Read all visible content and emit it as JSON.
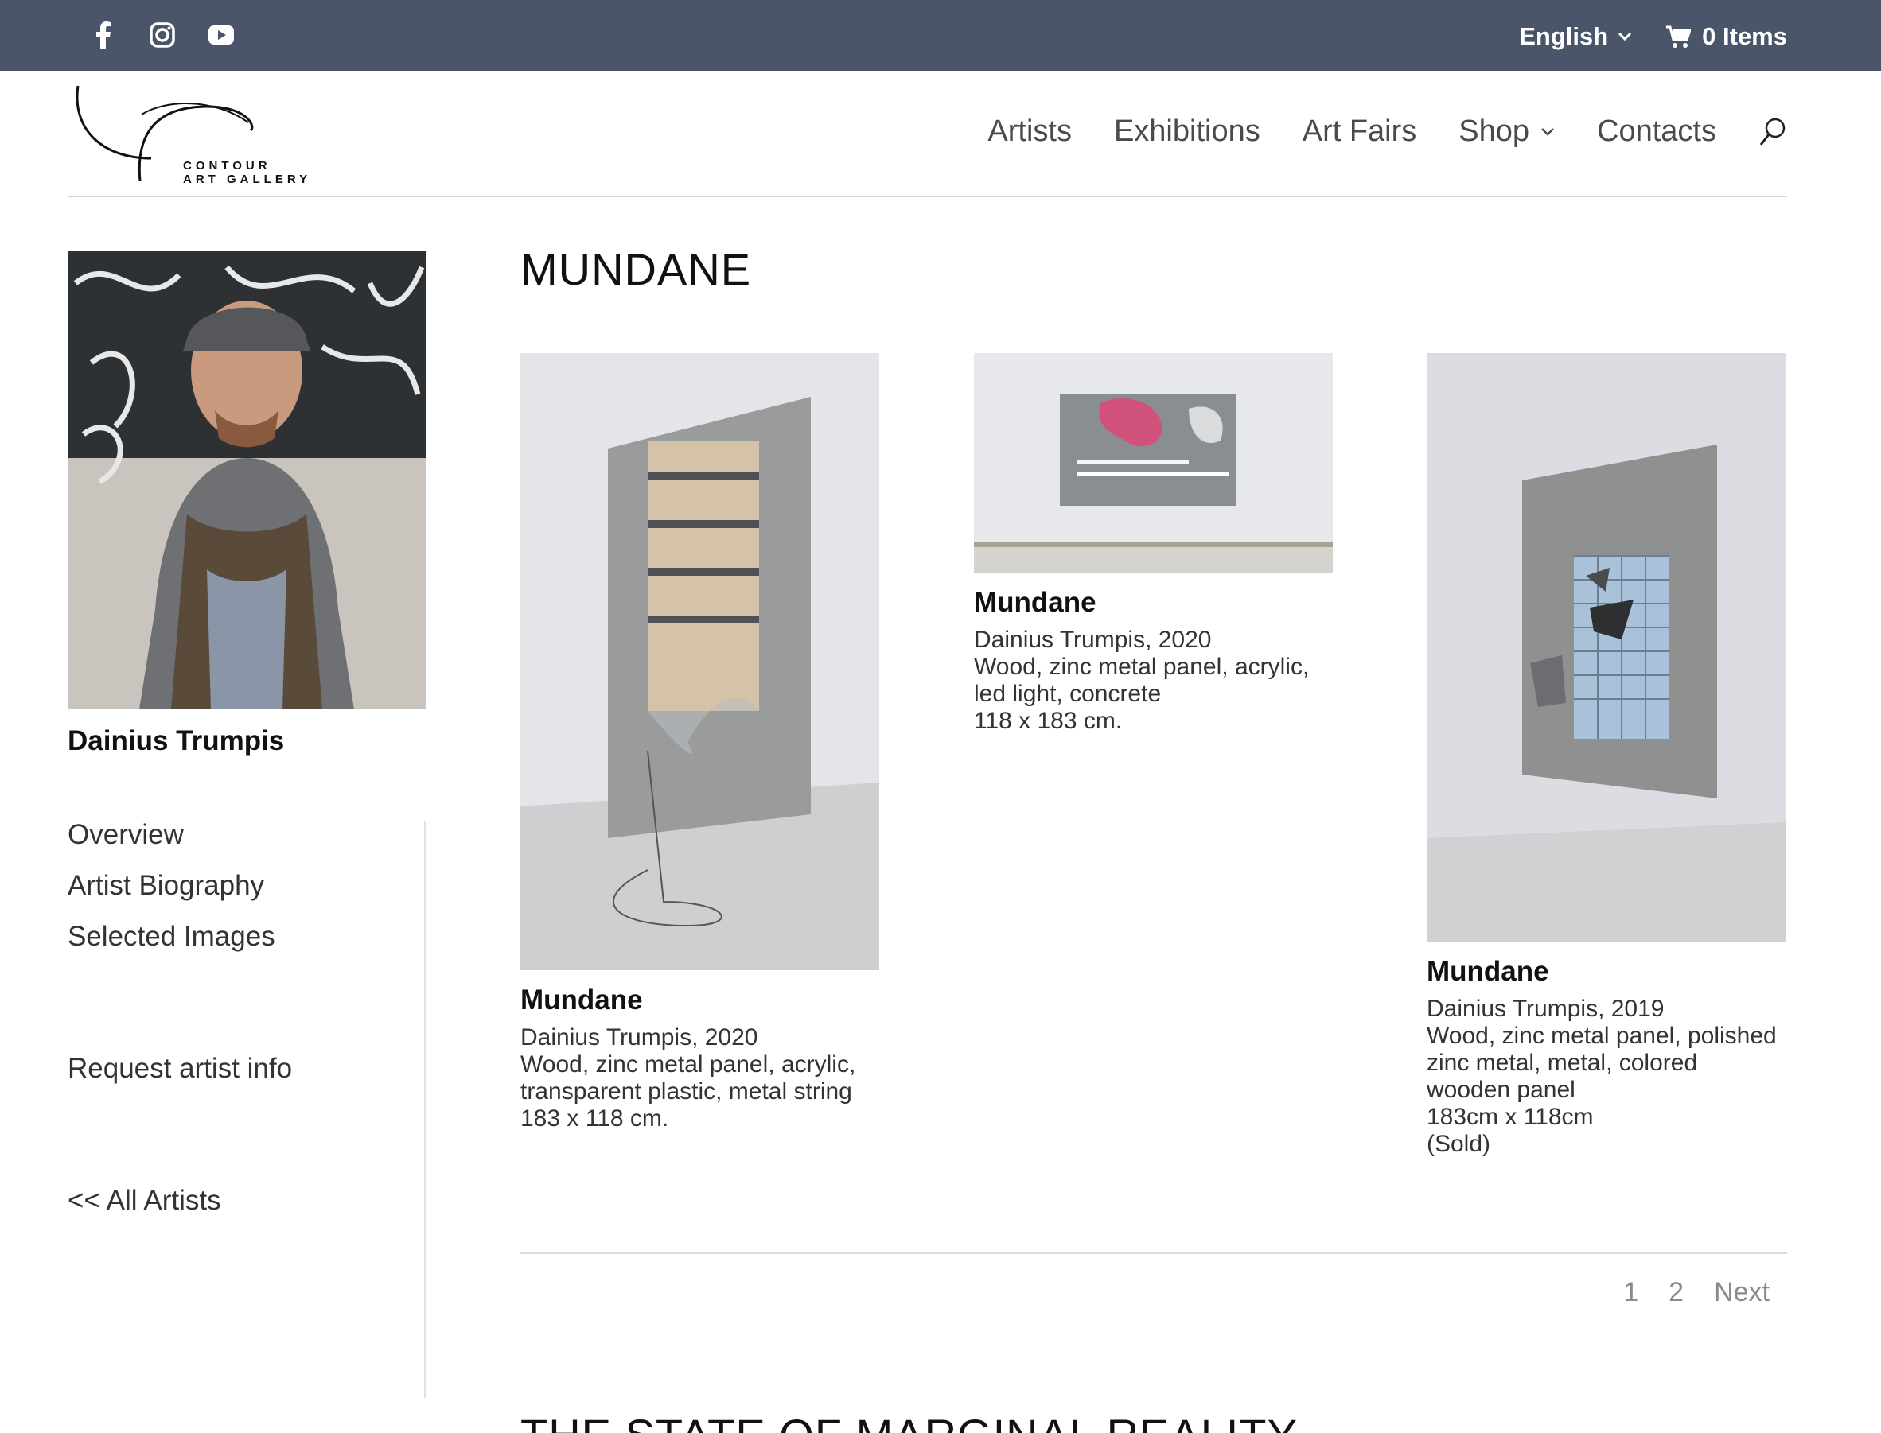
{
  "topbar": {
    "social": [
      "facebook-icon",
      "instagram-icon",
      "youtube-icon"
    ],
    "language": "English",
    "cart_label": "0 Items"
  },
  "logo": {
    "line1": "CONTOUR",
    "line2": "ART GALLERY"
  },
  "nav": {
    "items": [
      "Artists",
      "Exhibitions",
      "Art Fairs",
      "Shop",
      "Contacts"
    ]
  },
  "sidebar": {
    "artist_name": "Dainius Trumpis",
    "links": [
      "Overview",
      "Artist Biography",
      "Selected Images"
    ],
    "request_info": "Request artist info",
    "all_artists": "<< All Artists"
  },
  "main": {
    "title": "MUNDANE",
    "works": [
      {
        "title": "Mundane",
        "lines": [
          "Dainius Trumpis, 2020",
          "Wood, zinc metal panel, acrylic, transparent plastic, metal string",
          "183 x 118 cm."
        ]
      },
      {
        "title": "Mundane",
        "lines": [
          "Dainius Trumpis, 2020",
          "Wood, zinc metal panel, acrylic, led light, concrete",
          "118 x 183 cm."
        ]
      },
      {
        "title": "Mundane",
        "lines": [
          "Dainius Trumpis, 2019",
          "Wood, zinc metal panel, polished zinc metal, metal, colored wooden panel",
          "183cm x 118cm",
          "(Sold)"
        ]
      }
    ],
    "pagination": [
      "1",
      "2",
      "Next"
    ],
    "next_section_title": "THE STATE OF MARGINAL REALITY"
  }
}
